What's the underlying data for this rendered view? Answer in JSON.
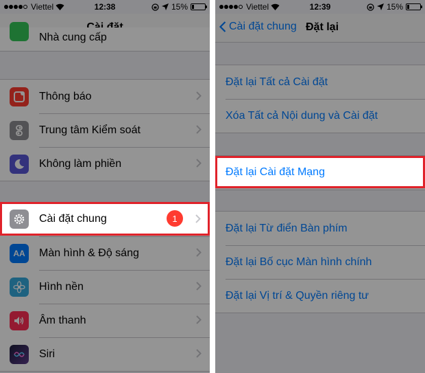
{
  "left": {
    "status": {
      "carrier": "Viettel",
      "time": "12:38",
      "battery": "15%"
    },
    "nav": {
      "title": "Cài đặt"
    },
    "partial_item": "Nhà cung cấp",
    "group1": [
      {
        "label": "Thông báo",
        "icon": "notifications-icon",
        "color": "#ff3b30"
      },
      {
        "label": "Trung tâm Kiểm soát",
        "icon": "control-center-icon",
        "color": "#8e8e93"
      },
      {
        "label": "Không làm phiền",
        "icon": "moon-icon",
        "color": "#5856d6"
      }
    ],
    "highlighted": {
      "label": "Cài đặt chung",
      "icon": "gear-icon",
      "color": "#8e8e93",
      "badge": "1"
    },
    "group2": [
      {
        "label": "Màn hình & Độ sáng",
        "icon": "display-brightness-icon",
        "color": "#007aff"
      },
      {
        "label": "Hình nền",
        "icon": "wallpaper-icon",
        "color": "#34aadc"
      },
      {
        "label": "Âm thanh",
        "icon": "sound-icon",
        "color": "#ff2d55"
      },
      {
        "label": "Siri",
        "icon": "siri-icon",
        "color": "#3a3a5a"
      }
    ]
  },
  "right": {
    "status": {
      "carrier": "Viettel",
      "time": "12:39",
      "battery": "15%"
    },
    "nav": {
      "back": "Cài đặt chung",
      "title": "Đặt lại"
    },
    "group1": [
      {
        "label": "Đặt lại Tất cả Cài đặt"
      },
      {
        "label": "Xóa Tất cả Nội dung và Cài đặt"
      }
    ],
    "highlighted": {
      "label": "Đặt lại Cài đặt Mạng"
    },
    "group3": [
      {
        "label": "Đặt lại Từ điển Bàn phím"
      },
      {
        "label": "Đặt lại Bố cục Màn hình chính"
      },
      {
        "label": "Đặt lại Vị trí & Quyền riêng tư"
      }
    ]
  },
  "colors": {
    "accent": "#007aff",
    "highlight_border": "#e0222a",
    "badge": "#ff3b30"
  }
}
